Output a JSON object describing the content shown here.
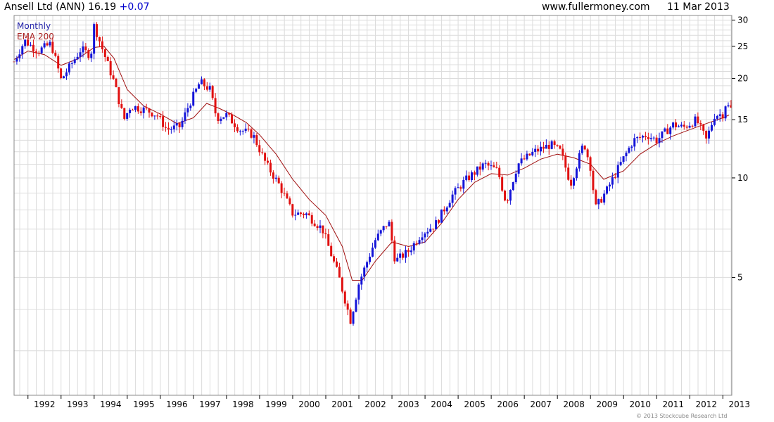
{
  "header": {
    "title": "Ansell Ltd (ANN) 16.19",
    "change": "+0.07",
    "site": "www.fullermoney.com",
    "date": "11 Mar 2013"
  },
  "legend": {
    "interval": "Monthly",
    "ema": "EMA 200"
  },
  "copyright": "© 2013 Stockcube Research Ltd",
  "colors": {
    "up": "#1414d8",
    "down": "#e01010",
    "ema": "#a01010",
    "grid": "#dcdcdc",
    "axis": "#000000"
  },
  "chart_data": {
    "type": "candlestick",
    "xlabel": "",
    "ylabel": "",
    "xlim": [
      1991.58,
      2013.27
    ],
    "ylim": [
      2.2,
      31.0
    ],
    "scale": "log",
    "grid": true,
    "y_axis_side": "right",
    "y_ticks": [
      5,
      10,
      15,
      20,
      25,
      30
    ],
    "x_ticks": [
      "1992",
      "1993",
      "1994",
      "1995",
      "1996",
      "1997",
      "1998",
      "1999",
      "2000",
      "2001",
      "2002",
      "2003",
      "2004",
      "2005",
      "2006",
      "2007",
      "2008",
      "2009",
      "2010",
      "2011",
      "2012",
      "2013"
    ],
    "series": [
      {
        "name": "Monthly",
        "style": "candles",
        "key_points": [
          [
            1991.58,
            22.5
          ],
          [
            1991.9,
            26.0
          ],
          [
            1992.3,
            24.2
          ],
          [
            1992.7,
            25.5
          ],
          [
            1993.0,
            19.8
          ],
          [
            1993.3,
            22.0
          ],
          [
            1993.6,
            24.5
          ],
          [
            1993.9,
            23.5
          ],
          [
            1994.0,
            29.0
          ],
          [
            1994.25,
            24.5
          ],
          [
            1994.6,
            19.5
          ],
          [
            1994.9,
            15.0
          ],
          [
            1995.1,
            16.5
          ],
          [
            1995.6,
            16.0
          ],
          [
            1995.9,
            15.5
          ],
          [
            1996.2,
            14.0
          ],
          [
            1996.6,
            14.3
          ],
          [
            1996.85,
            16.5
          ],
          [
            1997.2,
            19.5
          ],
          [
            1997.5,
            18.5
          ],
          [
            1997.7,
            15.2
          ],
          [
            1998.0,
            15.5
          ],
          [
            1998.4,
            14.0
          ],
          [
            1998.8,
            13.5
          ],
          [
            1999.2,
            11.0
          ],
          [
            1999.6,
            9.5
          ],
          [
            2000.0,
            7.8
          ],
          [
            2000.4,
            7.8
          ],
          [
            2000.9,
            7.0
          ],
          [
            2001.4,
            5.0
          ],
          [
            2001.75,
            3.7
          ],
          [
            2002.0,
            4.8
          ],
          [
            2002.5,
            6.5
          ],
          [
            2002.9,
            7.4
          ],
          [
            2003.1,
            5.6
          ],
          [
            2003.5,
            6.0
          ],
          [
            2003.9,
            6.8
          ],
          [
            2004.3,
            7.2
          ],
          [
            2004.8,
            8.8
          ],
          [
            2005.2,
            9.8
          ],
          [
            2005.8,
            11.0
          ],
          [
            2006.2,
            10.5
          ],
          [
            2006.45,
            8.4
          ],
          [
            2006.8,
            11.0
          ],
          [
            2007.3,
            12.0
          ],
          [
            2007.8,
            12.6
          ],
          [
            2008.1,
            12.0
          ],
          [
            2008.4,
            9.6
          ],
          [
            2008.8,
            12.8
          ],
          [
            2009.0,
            10.8
          ],
          [
            2009.15,
            8.1
          ],
          [
            2009.5,
            9.2
          ],
          [
            2009.9,
            11.0
          ],
          [
            2010.3,
            13.0
          ],
          [
            2010.7,
            13.5
          ],
          [
            2011.0,
            13.0
          ],
          [
            2011.5,
            14.5
          ],
          [
            2011.8,
            14.2
          ],
          [
            2012.2,
            15.0
          ],
          [
            2012.5,
            13.0
          ],
          [
            2012.75,
            15.5
          ],
          [
            2013.0,
            15.6
          ],
          [
            2013.1,
            17.0
          ],
          [
            2013.19,
            16.19
          ]
        ]
      },
      {
        "name": "EMA 200",
        "style": "line",
        "points": [
          [
            1991.58,
            22.8
          ],
          [
            1992.0,
            24.2
          ],
          [
            1992.5,
            23.6
          ],
          [
            1993.0,
            21.9
          ],
          [
            1993.5,
            22.9
          ],
          [
            1994.0,
            24.8
          ],
          [
            1994.3,
            25.0
          ],
          [
            1994.6,
            23.0
          ],
          [
            1995.0,
            18.5
          ],
          [
            1995.5,
            16.5
          ],
          [
            1996.0,
            15.6
          ],
          [
            1996.5,
            14.6
          ],
          [
            1997.0,
            15.2
          ],
          [
            1997.4,
            16.8
          ],
          [
            1997.8,
            16.2
          ],
          [
            1998.2,
            15.5
          ],
          [
            1998.6,
            14.7
          ],
          [
            1999.0,
            13.5
          ],
          [
            1999.5,
            11.8
          ],
          [
            2000.0,
            9.9
          ],
          [
            2000.5,
            8.6
          ],
          [
            2001.0,
            7.7
          ],
          [
            2001.5,
            6.2
          ],
          [
            2001.8,
            4.9
          ],
          [
            2002.1,
            4.9
          ],
          [
            2002.5,
            5.6
          ],
          [
            2003.0,
            6.4
          ],
          [
            2003.5,
            6.2
          ],
          [
            2004.0,
            6.4
          ],
          [
            2004.5,
            7.3
          ],
          [
            2005.0,
            8.6
          ],
          [
            2005.5,
            9.7
          ],
          [
            2006.0,
            10.3
          ],
          [
            2006.5,
            10.2
          ],
          [
            2007.0,
            10.7
          ],
          [
            2007.5,
            11.4
          ],
          [
            2008.0,
            11.8
          ],
          [
            2008.5,
            11.5
          ],
          [
            2009.0,
            11.0
          ],
          [
            2009.4,
            9.9
          ],
          [
            2010.0,
            10.5
          ],
          [
            2010.5,
            11.8
          ],
          [
            2011.0,
            12.7
          ],
          [
            2011.5,
            13.4
          ],
          [
            2012.0,
            14.0
          ],
          [
            2012.5,
            14.6
          ],
          [
            2013.0,
            15.2
          ],
          [
            2013.19,
            15.5
          ]
        ]
      }
    ]
  }
}
